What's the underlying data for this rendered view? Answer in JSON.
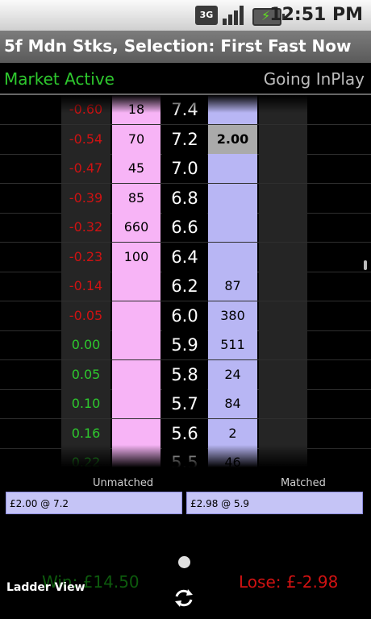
{
  "status_bar": {
    "time": "12:51 PM",
    "network": "3G"
  },
  "title": "5f Mdn Stks, Selection: First Fast Now",
  "market_status": "Market Active",
  "inplay_status": "Going InPlay",
  "ladder_rows": [
    {
      "change": "-0.60",
      "change_color": "#d01212",
      "back": "18",
      "price": "7.4",
      "lay": ""
    },
    {
      "change": "-0.54",
      "change_color": "#d01212",
      "back": "70",
      "price": "7.2",
      "lay": "2.00",
      "lay_selected": true
    },
    {
      "change": "-0.47",
      "change_color": "#d01212",
      "back": "45",
      "price": "7.0",
      "lay": ""
    },
    {
      "change": "-0.39",
      "change_color": "#d01212",
      "back": "85",
      "price": "6.8",
      "lay": ""
    },
    {
      "change": "-0.32",
      "change_color": "#d01212",
      "back": "660",
      "price": "6.6",
      "lay": ""
    },
    {
      "change": "-0.23",
      "change_color": "#d01212",
      "back": "100",
      "price": "6.4",
      "lay": ""
    },
    {
      "change": "-0.14",
      "change_color": "#d01212",
      "back": "",
      "price": "6.2",
      "lay": "87"
    },
    {
      "change": "-0.05",
      "change_color": "#d01212",
      "back": "",
      "price": "6.0",
      "lay": "380"
    },
    {
      "change": "0.00",
      "change_color": "#2ec82e",
      "back": "",
      "price": "5.9",
      "lay": "511"
    },
    {
      "change": "0.05",
      "change_color": "#2ec82e",
      "back": "",
      "price": "5.8",
      "lay": "24"
    },
    {
      "change": "0.10",
      "change_color": "#2ec82e",
      "back": "",
      "price": "5.7",
      "lay": "84"
    },
    {
      "change": "0.16",
      "change_color": "#2ec82e",
      "back": "",
      "price": "5.6",
      "lay": "2"
    },
    {
      "change": "0.22",
      "change_color": "#2ec82e",
      "back": "",
      "price": "5.5",
      "lay": "46"
    }
  ],
  "unmatched_label": "Unmatched",
  "matched_label": "Matched",
  "unmatched_value": "£2.00 @ 7.2",
  "matched_value": "£2.98 @ 5.9",
  "win_text": "Win: £14.50",
  "lose_text": "Lose: £-2.98",
  "ladder_view_label": "Ladder View",
  "icons": {
    "refresh": "refresh-icon",
    "dot": "page-indicator-dot"
  }
}
